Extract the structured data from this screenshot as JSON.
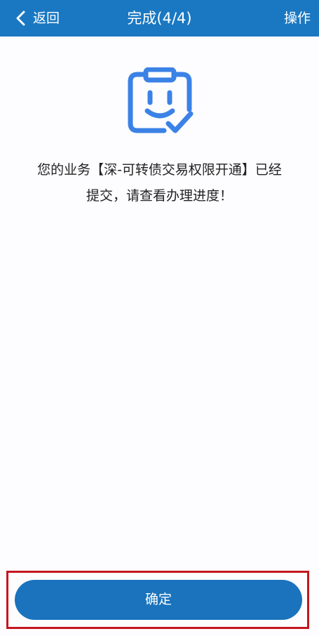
{
  "header": {
    "back_label": "返回",
    "title": "完成(4/4)",
    "action_label": "操作",
    "background_color": "#1a78c2"
  },
  "result": {
    "icon": "clipboard-smile-check-icon",
    "icon_color": "#3b82e6",
    "message_line1": "您的业务【深-可转债交易权限开通】已经",
    "message_line2": "提交，请查看办理进度！"
  },
  "footer": {
    "confirm_label": "确定",
    "button_color": "#1a73bc",
    "highlight_color": "#c4171e"
  }
}
